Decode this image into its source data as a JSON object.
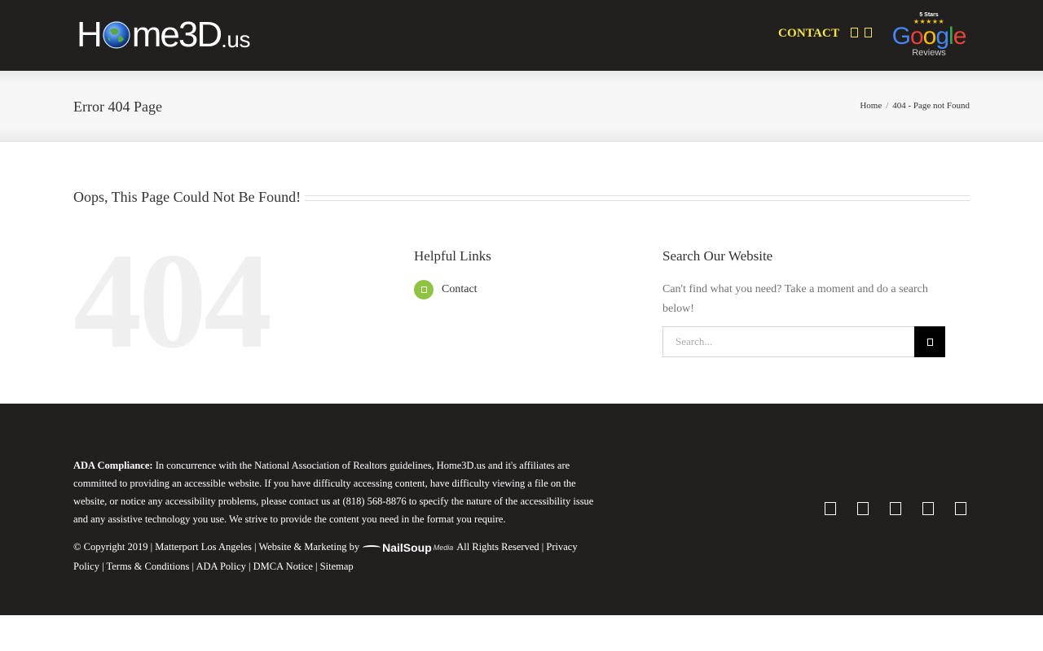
{
  "header": {
    "logo": {
      "part1": "H",
      "part2": "me3D",
      "part3": ".us"
    },
    "nav_contact": "CONTACT",
    "nav_icons": [
      "search-icon",
      "cart-icon"
    ],
    "google_badge": {
      "stars_label": "5 Stars",
      "stars": "★★★★★",
      "word": "Google",
      "reviews": "Reviews"
    }
  },
  "titlebar": {
    "title": "Error 404 Page",
    "breadcrumb": {
      "home": "Home",
      "separator": "/",
      "current": "404 - Page not Found"
    }
  },
  "main": {
    "heading": "Oops, This Page Could Not Be Found!",
    "big_number": "404",
    "helpful": {
      "title": "Helpful Links",
      "links": [
        {
          "label": "Contact"
        }
      ]
    },
    "search": {
      "title": "Search Our Website",
      "description": "Can't find what you need? Take a moment and do a search below!",
      "placeholder": "Search..."
    }
  },
  "footer": {
    "ada_label": "ADA Compliance:",
    "ada_text": " In concurrence with the National Association of Realtors guidelines, Home3D.us and it's affiliates are committed to providing an accessible website. If you have difficulty accessing content, have difficulty viewing a file on the website, or notice any accessibility problems, please contact us at (818) 568-8876 to specify the nature of the accessibility issue and any assistive technology you use. We strive to provide the content you need in the format you require.",
    "copyright_prefix": "© Copyright 2019 | Matterport Los Angeles | Website & Marketing by",
    "nailsoup": {
      "name": "NailSoup",
      "sub": "Media"
    },
    "copyright_suffix": "All Rights Reserved | Privacy Policy | Terms & Conditions | ADA Policy | DMCA Notice | Sitemap",
    "social_icons": [
      "facebook-icon",
      "twitter-icon",
      "instagram-icon",
      "youtube-icon",
      "linkedin-icon"
    ]
  },
  "colors": {
    "header_bg": "#221f1f",
    "nav_accent": "#f5e63b",
    "link_bullet": "#8fc442",
    "big_404": "#efefef"
  }
}
